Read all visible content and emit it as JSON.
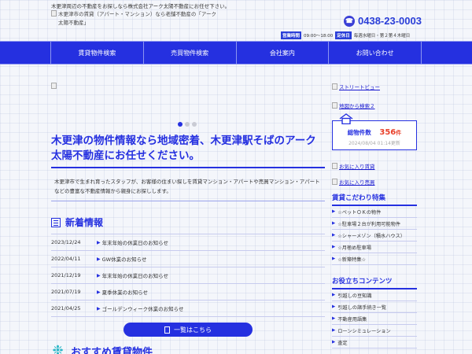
{
  "header": {
    "tagline": "木更津周辺の不動産をお探しなら株式会社アーク太陽不動産にお任せ下さい。",
    "logo_alt": "木更津市の賃貸（アパート・マンション）なら老舗不動産の「アーク太陽不動産」",
    "phone": "0438-23-0003",
    "hours_label": "営業時間",
    "hours_value": "09:00～18:00",
    "holiday_label": "定休日",
    "holiday_value": "毎週水曜日・第２第４木曜日"
  },
  "nav": [
    {
      "label": "賃貸物件検索"
    },
    {
      "label": "売買物件検索"
    },
    {
      "label": "会社案内"
    },
    {
      "label": "お問い合わせ"
    }
  ],
  "main": {
    "headline": "木更津の物件情報なら地域密着、木更津駅そばのアーク太陽不動産にお任せください。",
    "intro": "木更津市で生まれ育ったスタッフが、お客様の住まい探しを賃貸マンション・アパートや売買マンション・アパートなどの豊富な不動産情報から親身にお探しします。",
    "news_title": "新着情報",
    "news": [
      {
        "date": "2023/12/24",
        "text": "年末年始の休業日のお知らせ"
      },
      {
        "date": "2022/04/11",
        "text": "GW休業のお知らせ"
      },
      {
        "date": "2021/12/19",
        "text": "年末年始の休業日のお知らせ"
      },
      {
        "date": "2021/07/19",
        "text": "夏季休業のお知らせ"
      },
      {
        "date": "2021/04/25",
        "text": "ゴールデンウィーク休業のお知らせ"
      }
    ],
    "more_label": "一覧はこちら",
    "reco_title": "おすすめ賃貸物件"
  },
  "side": {
    "street_view": "ストリートビュー",
    "map_search": "地図から検索２",
    "count_label": "総物件数",
    "count_value": "356",
    "count_unit": "件",
    "count_date": "2024/08/04 01:14更新",
    "fav_rent": "お気に入り賃貸",
    "fav_sale": "お気に入り売買",
    "features_title": "賃貸こだわり特集",
    "features": [
      {
        "label": "☆ペットＯＫの物件"
      },
      {
        "label": "☆駐車場２台が利用可能物件"
      },
      {
        "label": "☆シャーメゾン（積水ハウス）"
      },
      {
        "label": "☆月極め駐車場"
      },
      {
        "label": "☆新築特集☆"
      }
    ],
    "contents_title": "お役立ちコンテンツ",
    "contents": [
      {
        "label": "引越しの豆知識"
      },
      {
        "label": "引越しの諸手続き一覧"
      },
      {
        "label": "不動産用語集"
      },
      {
        "label": "ローンシミュレーション"
      },
      {
        "label": "査定"
      }
    ]
  },
  "colors": {
    "primary": "#2530e0",
    "accent": "#e8402a",
    "teal": "#2fb8c8"
  }
}
